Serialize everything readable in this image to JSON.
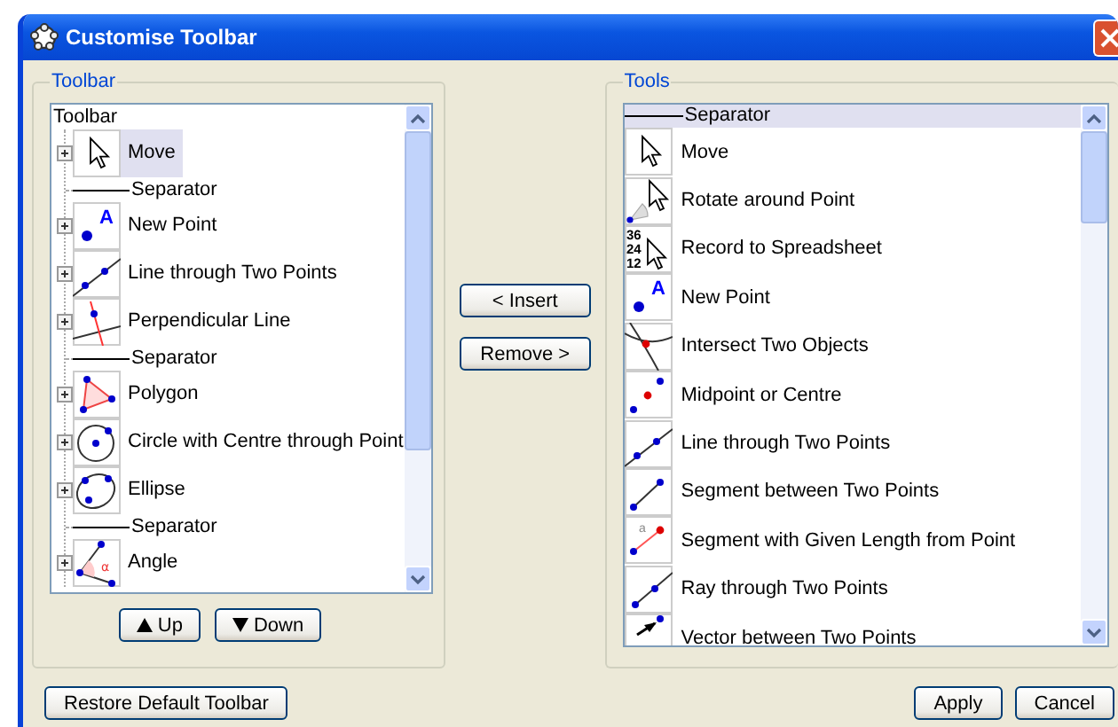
{
  "window": {
    "title": "Customise Toolbar"
  },
  "toolbar_panel": {
    "title": "Toolbar",
    "root": "Toolbar",
    "items": [
      {
        "kind": "tool",
        "label": "Move",
        "expanded": false,
        "selected": true
      },
      {
        "kind": "separator",
        "label": "Separator",
        "selected": false
      },
      {
        "kind": "tool",
        "label": "New Point",
        "icon_text": [
          "A"
        ],
        "expanded": false,
        "selected": false
      },
      {
        "kind": "tool",
        "label": "Line through Two Points",
        "expanded": false,
        "selected": false
      },
      {
        "kind": "tool",
        "label": "Perpendicular Line",
        "expanded": false,
        "selected": false
      },
      {
        "kind": "separator",
        "label": "Separator",
        "selected": false
      },
      {
        "kind": "tool",
        "label": "Polygon",
        "expanded": false,
        "selected": false
      },
      {
        "kind": "tool",
        "label": "Circle with Centre through Point",
        "expanded": false,
        "selected": false
      },
      {
        "kind": "tool",
        "label": "Ellipse",
        "expanded": false,
        "selected": false
      },
      {
        "kind": "separator",
        "label": "Separator",
        "selected": false
      },
      {
        "kind": "tool",
        "label": "Angle",
        "icon_text": [
          "α"
        ],
        "expanded": false,
        "selected": false
      }
    ],
    "buttons": [
      "Up",
      "Down"
    ]
  },
  "middle_buttons": [
    "< Insert",
    "Remove >"
  ],
  "tools_panel": {
    "title": "Tools",
    "items": [
      {
        "kind": "separator",
        "label": "Separator",
        "selected": true
      },
      {
        "kind": "tool",
        "label": "Move",
        "selected": false
      },
      {
        "kind": "tool",
        "label": "Rotate around Point",
        "selected": false
      },
      {
        "kind": "tool",
        "label": "Record to Spreadsheet",
        "icon_text": [
          "36",
          "24",
          "12"
        ],
        "selected": false
      },
      {
        "kind": "tool",
        "label": "New Point",
        "icon_text": [
          "A"
        ],
        "selected": false
      },
      {
        "kind": "tool",
        "label": "Intersect Two Objects",
        "selected": false
      },
      {
        "kind": "tool",
        "label": "Midpoint or Centre",
        "selected": false
      },
      {
        "kind": "tool",
        "label": "Line through Two Points",
        "selected": false
      },
      {
        "kind": "tool",
        "label": "Segment between Two Points",
        "selected": false
      },
      {
        "kind": "tool",
        "label": "Segment with Given Length from Point",
        "icon_text": [
          "a"
        ],
        "selected": false
      },
      {
        "kind": "tool",
        "label": "Ray through Two Points",
        "selected": false
      },
      {
        "kind": "tool",
        "label": "Vector between Two Points",
        "selected": false
      }
    ]
  },
  "footer": {
    "restore": "Restore Default Toolbar",
    "buttons": [
      "Apply",
      "Cancel"
    ]
  }
}
